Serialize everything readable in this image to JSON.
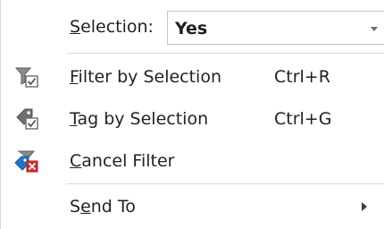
{
  "selection": {
    "label_access_key": "S",
    "label_rest": "election:",
    "value": "Yes"
  },
  "menu_items": [
    {
      "access_key": "F",
      "label_rest": "ilter by Selection",
      "shortcut": "Ctrl+R",
      "icon": "filter-by-selection-icon"
    },
    {
      "access_key": "T",
      "label_rest": "ag by Selection",
      "shortcut": "Ctrl+G",
      "icon": "tag-by-selection-icon"
    },
    {
      "access_key": "C",
      "label_rest": "ancel Filter",
      "shortcut": "",
      "icon": "cancel-filter-icon"
    },
    {
      "label_pre": "S",
      "access_key": "e",
      "label_rest": "nd To",
      "shortcut": "",
      "icon": "submenu-arrow-icon"
    }
  ],
  "colors": {
    "text": "#222222",
    "separator": "#dcdcdc",
    "icon_gray": "#7a7a7a",
    "icon_blue": "#1f76c8",
    "icon_red": "#d62b2b"
  }
}
